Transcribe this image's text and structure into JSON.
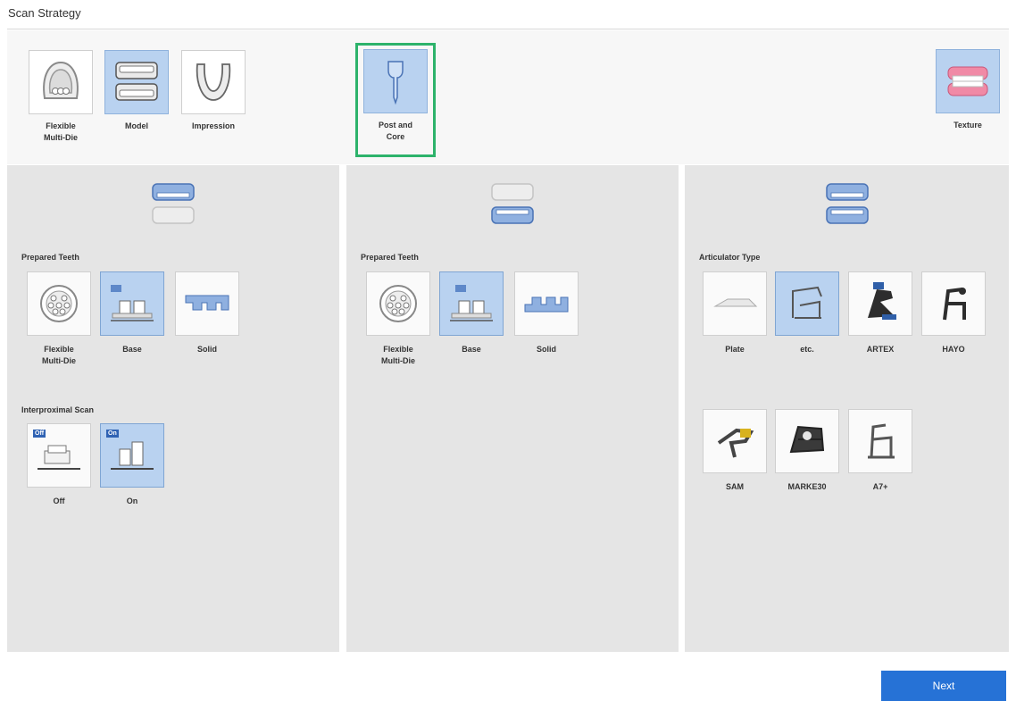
{
  "window": {
    "title": "Scan Strategy"
  },
  "top_tiles": {
    "flexible_multi_die": {
      "line1": "Flexible",
      "line2": "Multi-Die",
      "selected": false
    },
    "model": {
      "label": "Model",
      "selected": true
    },
    "impression": {
      "label": "Impression",
      "selected": false
    },
    "post_and_core": {
      "line1": "Post and",
      "line2": "Core",
      "selected": true
    },
    "texture": {
      "label": "Texture",
      "selected": true
    }
  },
  "panel_left": {
    "jaw_icon": "upper-jaw-icon",
    "prepared_teeth_label": "Prepared Teeth",
    "options": [
      {
        "line1": "Flexible",
        "line2": "Multi-Die",
        "selected": false
      },
      {
        "line1": "Base",
        "line2": "",
        "selected": true
      },
      {
        "line1": "Solid",
        "line2": "",
        "selected": false
      }
    ],
    "interproximal_label": "Interproximal Scan",
    "interproximal_options": [
      {
        "label": "Off",
        "badge": "Off",
        "selected": false
      },
      {
        "label": "On",
        "badge": "On",
        "selected": true
      }
    ]
  },
  "panel_middle": {
    "jaw_icon": "lower-jaw-icon",
    "prepared_teeth_label": "Prepared Teeth",
    "options": [
      {
        "line1": "Flexible",
        "line2": "Multi-Die",
        "selected": false
      },
      {
        "line1": "Base",
        "line2": "",
        "selected": true
      },
      {
        "line1": "Solid",
        "line2": "",
        "selected": false
      }
    ]
  },
  "panel_right": {
    "jaw_icon": "both-jaws-icon",
    "articulator_label": "Articulator Type",
    "articulators": [
      {
        "label": "Plate",
        "selected": false
      },
      {
        "label": "etc.",
        "selected": true
      },
      {
        "label": "ARTEX",
        "selected": false
      },
      {
        "label": "HAYO",
        "selected": false
      },
      {
        "label": "SAM",
        "selected": false
      },
      {
        "label": "MARKE30",
        "selected": false
      },
      {
        "label": "A7+",
        "selected": false
      }
    ]
  },
  "footer": {
    "next_label": "Next"
  },
  "colors": {
    "accent": "#2672d6",
    "selected_fill": "#b9d2f0",
    "highlight_frame": "#2db36b",
    "panel_bg": "#e5e5e5"
  }
}
